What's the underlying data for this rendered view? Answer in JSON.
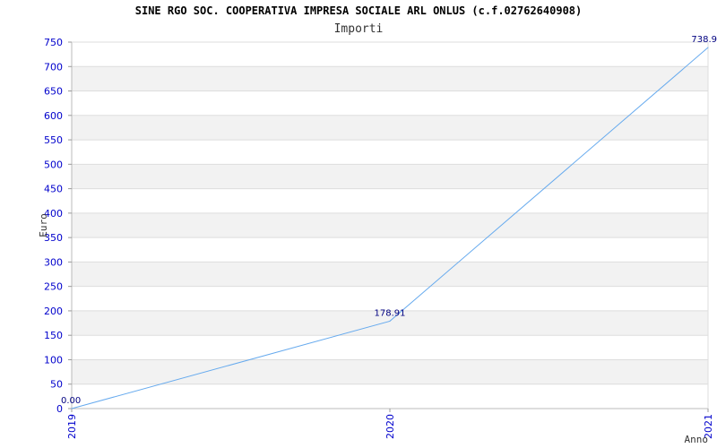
{
  "chart_data": {
    "type": "line",
    "title": "SINE RGO SOC. COOPERATIVA IMPRESA SOCIALE ARL ONLUS (c.f.02762640908)",
    "subtitle": "Importi",
    "xlabel": "Anno",
    "ylabel": "Euro",
    "categories": [
      "2019",
      "2020",
      "2021"
    ],
    "series": [
      {
        "values": [
          0.0,
          178.91,
          738.9
        ]
      }
    ],
    "data_labels": [
      "0.00",
      "178.91",
      "738.9"
    ],
    "ylim": [
      0,
      750
    ],
    "yticks": [
      0,
      50,
      100,
      150,
      200,
      250,
      300,
      350,
      400,
      450,
      500,
      550,
      600,
      650,
      700,
      750
    ],
    "grid": true,
    "colors": {
      "line": "#66aaee",
      "band": "#f2f2f2",
      "tick_text": "#0000cc",
      "data_label": "#000080"
    }
  }
}
